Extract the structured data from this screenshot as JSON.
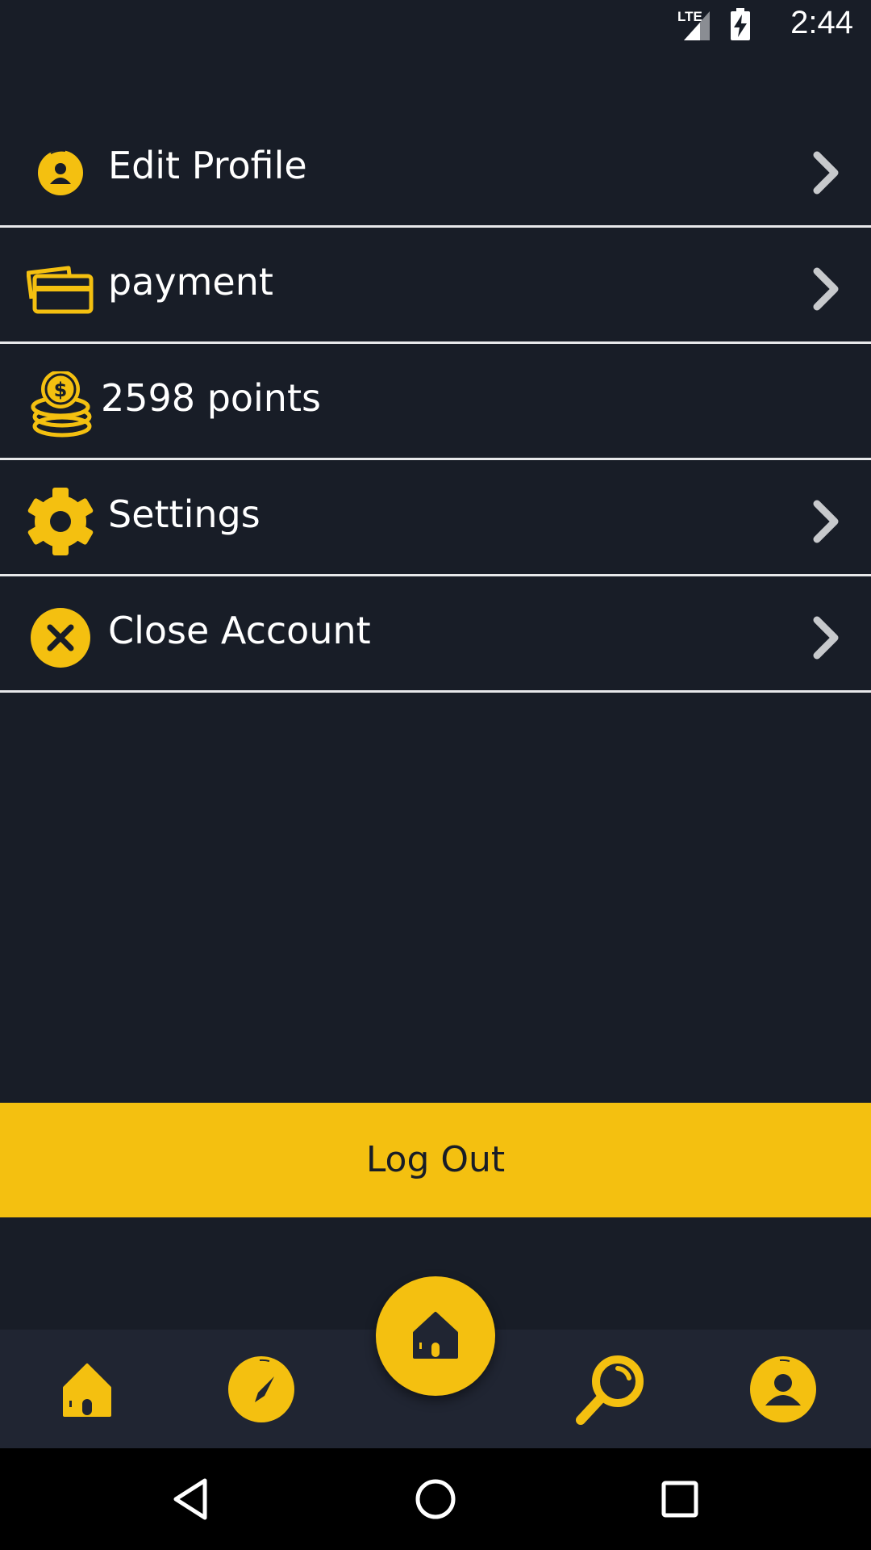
{
  "status_bar": {
    "time": "2:44",
    "network": "LTE",
    "icons": [
      "lte-signal-icon",
      "battery-charging-icon"
    ]
  },
  "menu": {
    "items": [
      {
        "label": "Edit Profile",
        "icon": "profile-icon",
        "chevron": true
      },
      {
        "label": "payment",
        "icon": "card-icon",
        "chevron": true
      },
      {
        "label": "2598 points",
        "icon": "coins-icon",
        "chevron": false
      },
      {
        "label": "Settings",
        "icon": "gear-icon",
        "chevron": true
      },
      {
        "label": "Close Account",
        "icon": "close-circle-icon",
        "chevron": true
      }
    ]
  },
  "logout": {
    "label": "Log Out"
  },
  "bottom_nav": {
    "items": [
      "home-icon",
      "compass-icon",
      "home-fab-icon",
      "search-icon",
      "profile-icon"
    ]
  },
  "system_nav": {
    "items": [
      "back-icon",
      "home-circle-icon",
      "recents-icon"
    ]
  },
  "colors": {
    "background": "#181d27",
    "accent": "#f4c010",
    "nav_background": "#202532",
    "divider": "#e7e8ea",
    "chevron": "#c7c9cc"
  }
}
